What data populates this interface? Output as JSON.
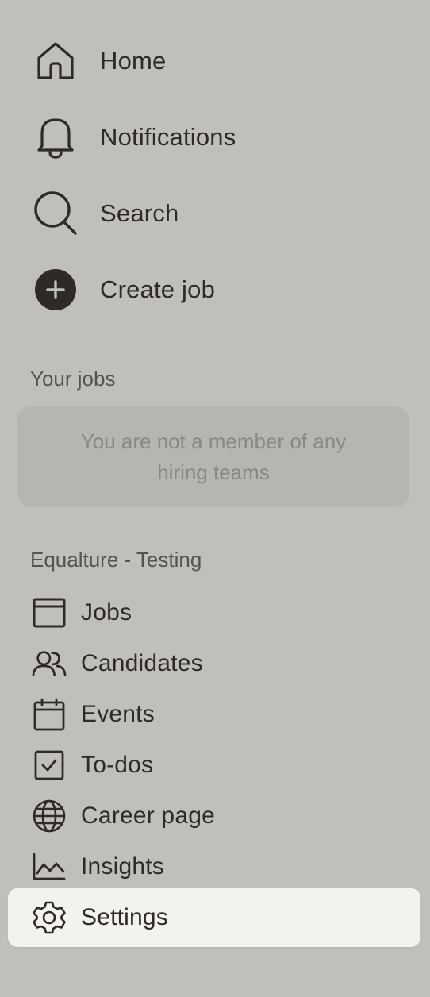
{
  "top_nav": [
    {
      "label": "Home",
      "icon": "home-icon"
    },
    {
      "label": "Notifications",
      "icon": "bell-icon"
    },
    {
      "label": "Search",
      "icon": "search-icon"
    },
    {
      "label": "Create job",
      "icon": "plus-circle-icon"
    }
  ],
  "your_jobs": {
    "heading": "Your jobs",
    "empty_message": "You are not a member of any hiring teams"
  },
  "org": {
    "heading": "Equalture - Testing",
    "items": [
      {
        "label": "Jobs",
        "icon": "browser-window-icon"
      },
      {
        "label": "Candidates",
        "icon": "users-icon"
      },
      {
        "label": "Events",
        "icon": "calendar-icon"
      },
      {
        "label": "To-dos",
        "icon": "checkbox-icon"
      },
      {
        "label": "Career page",
        "icon": "globe-icon"
      },
      {
        "label": "Insights",
        "icon": "chart-line-icon"
      },
      {
        "label": "Settings",
        "icon": "gear-icon",
        "active": true
      }
    ]
  },
  "colors": {
    "background": "#c0bfbb",
    "text": "#2f2a28",
    "muted_text": "#575350",
    "empty_box": "#b6b5b1",
    "active_bg": "#f3f2ef"
  }
}
